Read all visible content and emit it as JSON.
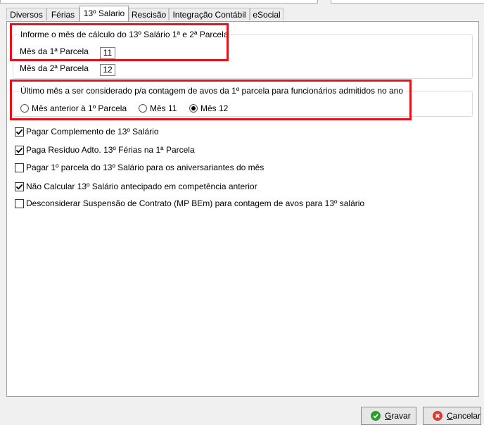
{
  "tabs": [
    "Diversos",
    "Férias",
    "13º Salario",
    "Rescisão",
    "Integração Contábil",
    "eSocial"
  ],
  "group_calc": {
    "legend": "Informe o mês de cálculo do 13º Salário 1ª e 2ª Parcela",
    "parcela1_label": "Mês da 1ª Parcela",
    "parcela1_value": "11",
    "parcela2_label": "Mês da 2ª Parcela",
    "parcela2_value": "12"
  },
  "group_avos": {
    "legend": "Último mês a ser considerado p/a contagem de avos da 1º parcela para funcionários admitidos no ano",
    "options": [
      "Mês anterior à 1º Parcela",
      "Mês 11",
      "Mês 12"
    ],
    "selected": "Mês 12"
  },
  "checkboxes": [
    {
      "label": "Pagar Complemento de 13º Salário",
      "checked": true
    },
    {
      "label": "Paga Resíduo Adto. 13º Férias na 1ª Parcela",
      "checked": true
    },
    {
      "label": "Pagar 1º parcela do 13º Salário para os aniversariantes do mês",
      "checked": false
    },
    {
      "label": "Não Calcular 13º Salário antecipado em competência anterior",
      "checked": true
    },
    {
      "label": "Desconsiderar Suspensão de Contrato (MP BEm) para contagem de avos para 13º salário",
      "checked": false
    }
  ],
  "buttons": {
    "save_first": "G",
    "save_rest": "ravar",
    "cancel_first": "C",
    "cancel_rest": "ancelar"
  },
  "colors": {
    "highlight": "#e0141c",
    "save_icon": "#2e9e2e",
    "cancel_icon": "#d93a3a"
  }
}
